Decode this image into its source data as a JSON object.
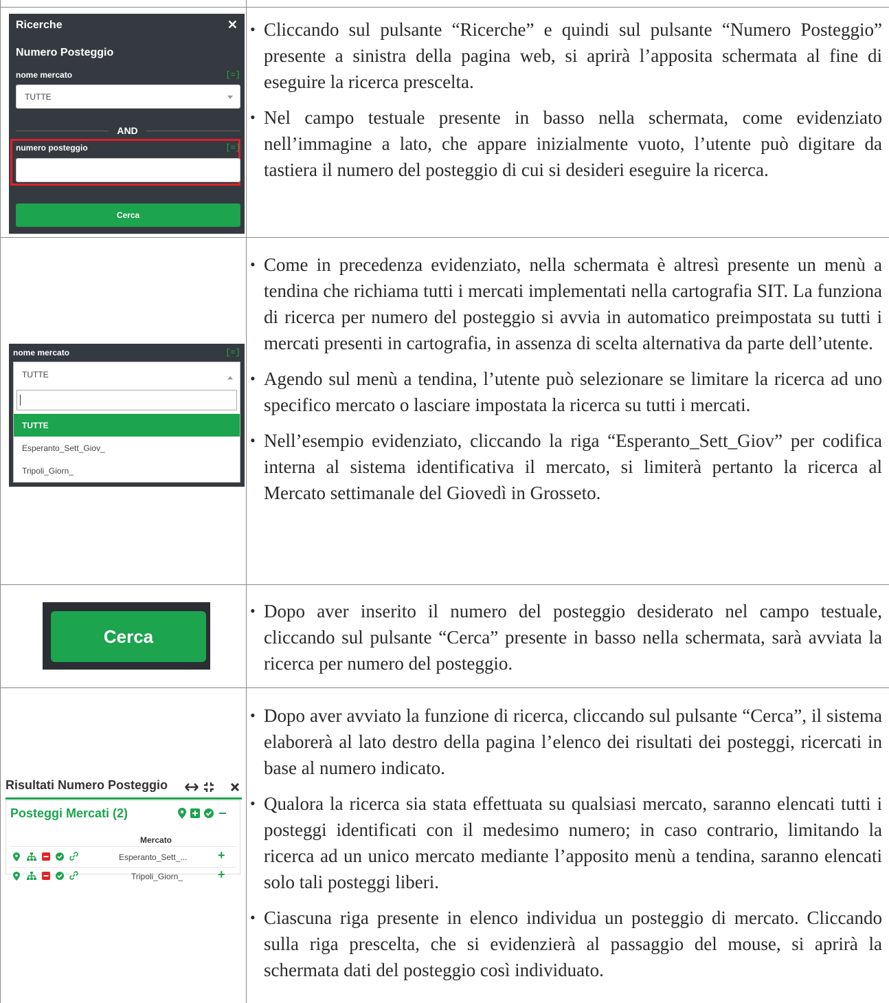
{
  "row1": {
    "panel": {
      "title": "Ricerche",
      "close_glyph": "✕",
      "subtitle": "Numero Posteggio",
      "mercato_label": "nome mercato",
      "eq_tag": "[=]",
      "mercato_value": "TUTTE",
      "and_label": "AND",
      "posteggio_label": "numero posteggio",
      "posteggio_value": "",
      "search_button": "Cerca"
    },
    "bullets": [
      "Cliccando sul pulsante “Ricerche” e quindi sul pulsante “Numero Posteggio” presente a sinistra della pagina web, si aprirà l’apposita schermata al fine di eseguire la ricerca prescelta.",
      "Nel campo testuale presente in basso nella schermata, come evidenziato nell’immagine a lato, che appare inizialmente vuoto, l’utente può digitare da tastiera il numero del posteggio di cui si desideri eseguire la ricerca."
    ]
  },
  "row2": {
    "panel": {
      "mercato_label": "nome mercato",
      "eq_tag": "[=]",
      "mercato_value": "TUTTE",
      "options": [
        "TUTTE",
        "Esperanto_Sett_Giov_",
        "Tripoli_Giorn_"
      ],
      "selected_index": 0
    },
    "bullets": [
      "Come in precedenza evidenziato, nella schermata è altresì presente un menù a tendina che richiama tutti i mercati implementati nella cartografia SIT. La funziona di ricerca per numero del posteggio si avvia in automatico preimpostata su tutti i mercati presenti in cartografia, in assenza di scelta alternativa da parte dell’utente.",
      "Agendo sul menù a tendina, l’utente può selezionare se limitare la ricerca ad uno specifico mercato o lasciare impostata la ricerca su tutti i mercati.",
      "Nell’esempio evidenziato, cliccando la riga “Esperanto_Sett_Giov” per codifica interna al sistema identificativa il mercato, si limiterà pertanto la ricerca al Mercato settimanale del Giovedì in Grosseto."
    ]
  },
  "row3": {
    "button_label": "Cerca",
    "bullets": [
      "Dopo aver inserito il numero del posteggio desiderato nel campo testuale, cliccando sul pulsante “Cerca” presente in basso nella schermata, sarà avviata la ricerca per numero del posteggio."
    ]
  },
  "row4": {
    "panel": {
      "title": "Risultati Numero Posteggio",
      "group_title": "Posteggi Mercati (2)",
      "column_header": "Mercato",
      "rows": [
        {
          "mercato": "Esperanto_Sett_..."
        },
        {
          "mercato": "Tripoli_Giorn_"
        }
      ],
      "accent_color": "#1ca44e",
      "delete_color": "#e02424"
    },
    "bullets": [
      "Dopo aver avviato la funzione di ricerca, cliccando sul pulsante “Cerca”, il sistema elaborerà al lato destro della pagina l’elenco dei risultati dei posteggi, ricercati in base al numero indicato.",
      "Qualora la ricerca sia stata effettuata su qualsiasi mercato, saranno elencati tutti i posteggi identificati con il medesimo numero; in caso contrario, limitando la ricerca ad un unico mercato mediante l’apposito menù a tendina, saranno elencati solo tali posteggi liberi.",
      "Ciascuna riga presente in elenco individua un posteggio di mercato. Cliccando sulla riga prescelta, che si evidenzierà al passaggio del mouse, si aprirà la schermata dati del posteggio così individuato."
    ]
  }
}
